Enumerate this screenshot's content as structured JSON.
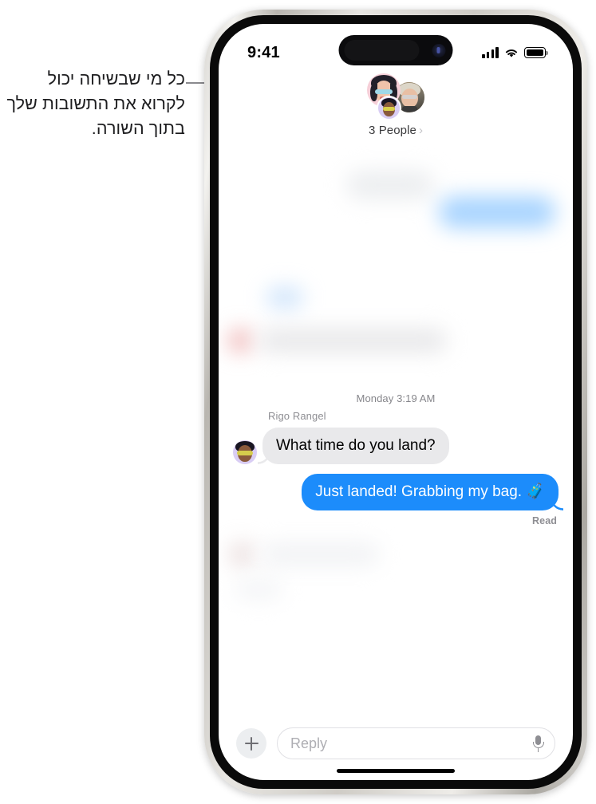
{
  "callout": {
    "text": "כל מי שבשיחה יכול לקרוא את התשובות שלך בתוך השורה."
  },
  "status_bar": {
    "time": "9:41",
    "cellular_icon": "signal-bars-icon",
    "wifi_icon": "wifi-icon",
    "battery_icon": "battery-full-icon"
  },
  "group_header": {
    "participants_label": "3 People",
    "chevron": "›",
    "avatars": [
      {
        "name": "avatar-memoji-pink",
        "type": "memoji",
        "bg": "#f6cfd8"
      },
      {
        "name": "avatar-photo-person",
        "type": "photo",
        "bg": "#c9b79a"
      },
      {
        "name": "avatar-memoji-purple",
        "type": "memoji",
        "bg": "#d9cdf4"
      }
    ]
  },
  "conversation": {
    "timestamp": "Monday 3:19 AM",
    "messages": [
      {
        "id": "blurred-in-1",
        "direction": "incoming",
        "blurred": true,
        "color": "#eceef0"
      },
      {
        "id": "blurred-out-1",
        "direction": "outgoing",
        "blurred": true,
        "color": "#a8d4ff"
      },
      {
        "id": "blurred-in-2",
        "direction": "incoming",
        "blurred": true,
        "color": "#edeef0"
      },
      {
        "id": "msg-incoming",
        "direction": "incoming",
        "blurred": false,
        "sender": "Rigo Rangel",
        "text": "What time do you land?",
        "color": "#e9e9eb"
      },
      {
        "id": "msg-outgoing",
        "direction": "outgoing",
        "blurred": false,
        "text": "Just landed! Grabbing my bag. 🧳",
        "status": "Read",
        "color": "#1c8cfb"
      },
      {
        "id": "blurred-in-3",
        "direction": "incoming",
        "blurred": true,
        "color": "#f3f4f6"
      }
    ]
  },
  "input_bar": {
    "add_button_icon": "plus-icon",
    "reply_placeholder": "Reply",
    "mic_icon": "microphone-icon"
  },
  "colors": {
    "imessage_blue": "#1c8cfb",
    "received_gray": "#e9e9eb",
    "secondary_text": "#8e8e93",
    "leader_line": "#8a8a8e"
  }
}
